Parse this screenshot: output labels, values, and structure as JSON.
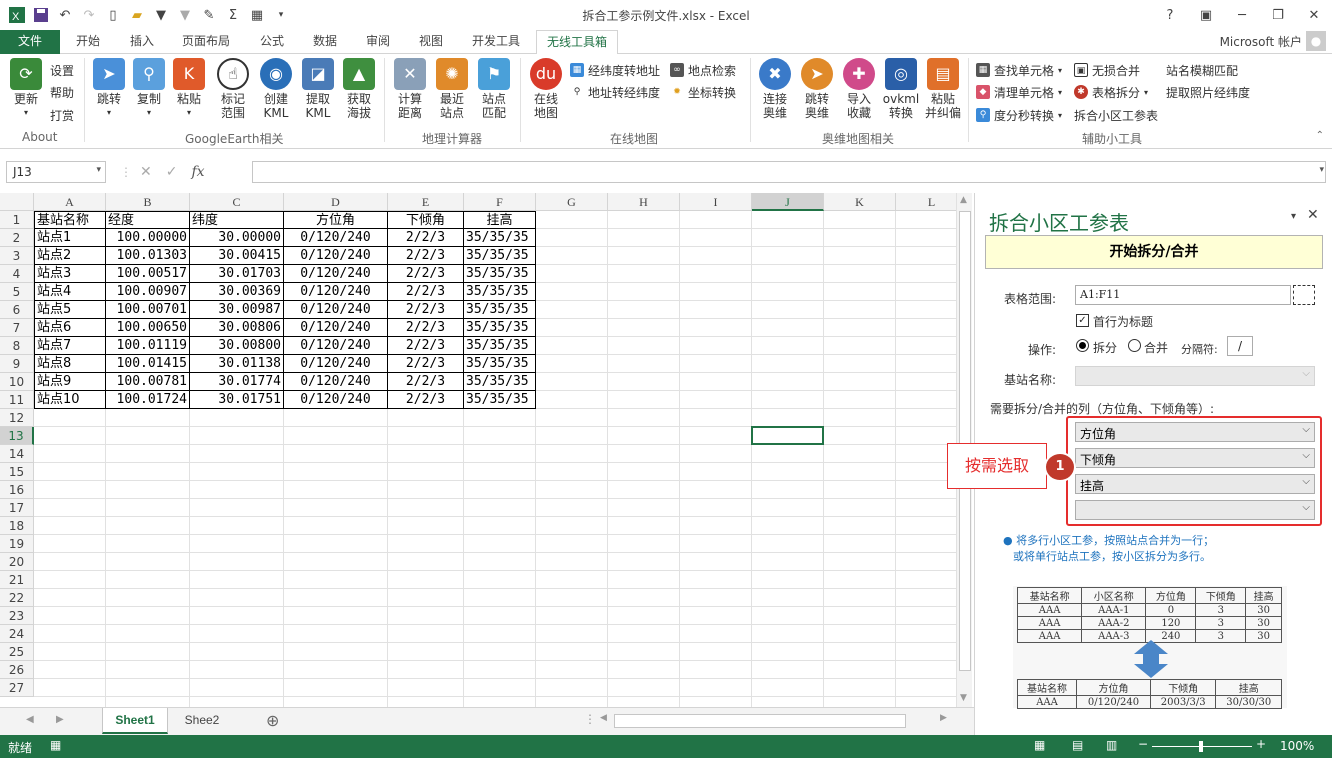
{
  "window": {
    "title": "拆合工参示例文件.xlsx - Excel",
    "help": "?",
    "minimize": "─",
    "restore": "❐",
    "close": "✕"
  },
  "tabs": [
    "文件",
    "开始",
    "插入",
    "页面布局",
    "公式",
    "数据",
    "审阅",
    "视图",
    "开发工具",
    "无线工具箱"
  ],
  "account": "Microsoft 帐户",
  "ribbon": {
    "about": {
      "buttons": [
        "更新"
      ],
      "small": [
        "设置",
        "帮助",
        "打赏"
      ],
      "label": "About"
    },
    "ge": {
      "buttons": [
        "跳转",
        "复制",
        "粘贴",
        "标记\n范围",
        "创建\nKML",
        "提取\nKML",
        "获取\n海拔"
      ],
      "label": "GoogleEarth相关"
    },
    "geo": {
      "buttons": [
        "计算\n距离",
        "最近\n站点",
        "站点\n匹配"
      ],
      "label": "地理计算器"
    },
    "online": {
      "buttons": [
        "在线\n地图"
      ],
      "small": [
        "经纬度转地址",
        "地址转经纬度",
        "地点检索",
        "坐标转换"
      ],
      "label": "在线地图"
    },
    "ovi": {
      "buttons": [
        "连接\n奥维",
        "跳转\n奥维",
        "导入\n收藏",
        "ovkml\n转换",
        "粘贴\n并纠偏"
      ],
      "label": "奥维地图相关"
    },
    "tools": {
      "small": [
        "查找单元格",
        "清理单元格",
        "度分秒转换",
        "无损合并",
        "表格拆分",
        "拆合小区工参表",
        "站名模糊匹配",
        "提取照片经纬度"
      ],
      "label": "辅助小工具"
    }
  },
  "formula": {
    "namebox": "J13",
    "cancel": "✕",
    "enter": "✓",
    "fx": "fx",
    "value": ""
  },
  "sheet": {
    "columns": [
      "A",
      "B",
      "C",
      "D",
      "E",
      "F",
      "G",
      "H",
      "I",
      "J",
      "K",
      "L"
    ],
    "rows": [
      "1",
      "2",
      "3",
      "4",
      "5",
      "6",
      "7",
      "8",
      "9",
      "10",
      "11",
      "12",
      "13",
      "14",
      "15",
      "16",
      "17",
      "18",
      "19",
      "20",
      "21",
      "22",
      "23",
      "24",
      "25",
      "26",
      "27"
    ],
    "header": [
      "基站名称",
      "经度",
      "纬度",
      "方位角",
      "下倾角",
      "挂高"
    ],
    "data": [
      [
        "站点1",
        "100.00000",
        "30.00000",
        "0/120/240",
        "2/2/3",
        "35/35/35"
      ],
      [
        "站点2",
        "100.01303",
        "30.00415",
        "0/120/240",
        "2/2/3",
        "35/35/35"
      ],
      [
        "站点3",
        "100.00517",
        "30.01703",
        "0/120/240",
        "2/2/3",
        "35/35/35"
      ],
      [
        "站点4",
        "100.00907",
        "30.00369",
        "0/120/240",
        "2/2/3",
        "35/35/35"
      ],
      [
        "站点5",
        "100.00701",
        "30.00987",
        "0/120/240",
        "2/2/3",
        "35/35/35"
      ],
      [
        "站点6",
        "100.00650",
        "30.00806",
        "0/120/240",
        "2/2/3",
        "35/35/35"
      ],
      [
        "站点7",
        "100.01119",
        "30.00800",
        "0/120/240",
        "2/2/3",
        "35/35/35"
      ],
      [
        "站点8",
        "100.01415",
        "30.01138",
        "0/120/240",
        "2/2/3",
        "35/35/35"
      ],
      [
        "站点9",
        "100.00781",
        "30.01774",
        "0/120/240",
        "2/2/3",
        "35/35/35"
      ],
      [
        "站点10",
        "100.01724",
        "30.01751",
        "0/120/240",
        "2/2/3",
        "35/35/35"
      ]
    ],
    "tabs": [
      "Sheet1",
      "Shee2"
    ],
    "add_sheet": "⊕"
  },
  "status": {
    "ready": "就绪",
    "zoom": "100%",
    "minus": "−",
    "plus": "+"
  },
  "pane": {
    "title": "拆合小区工参表",
    "start_button": "开始拆分/合并",
    "range_label": "表格范围:",
    "range_value": "A1:F11",
    "header_check": "首行为标题",
    "op_label": "操作:",
    "op_split": "拆分",
    "op_merge": "合并",
    "sep_label": "分隔符:",
    "sep_value": "/",
    "station_label": "基站名称:",
    "cols_label": "需要拆分/合并的列（方位角、下倾角等）:",
    "cols": [
      "方位角",
      "下倾角",
      "挂高",
      ""
    ],
    "callout": "按需选取",
    "badge": "1",
    "note1": "● 将多行小区工参，按照站点合并为一行；",
    "note2": "或将单行站点工参，按小区拆分为多行。",
    "ex_top_header": [
      "基站名称",
      "小区名称",
      "方位角",
      "下倾角",
      "挂高"
    ],
    "ex_top_rows": [
      [
        "AAA",
        "AAA-1",
        "0",
        "3",
        "30"
      ],
      [
        "AAA",
        "AAA-2",
        "120",
        "3",
        "30"
      ],
      [
        "AAA",
        "AAA-3",
        "240",
        "3",
        "30"
      ]
    ],
    "ex_bottom_header": [
      "基站名称",
      "方位角",
      "下倾角",
      "挂高"
    ],
    "ex_bottom_row": [
      "AAA",
      "0/120/240",
      "2003/3/3",
      "30/30/30"
    ]
  }
}
